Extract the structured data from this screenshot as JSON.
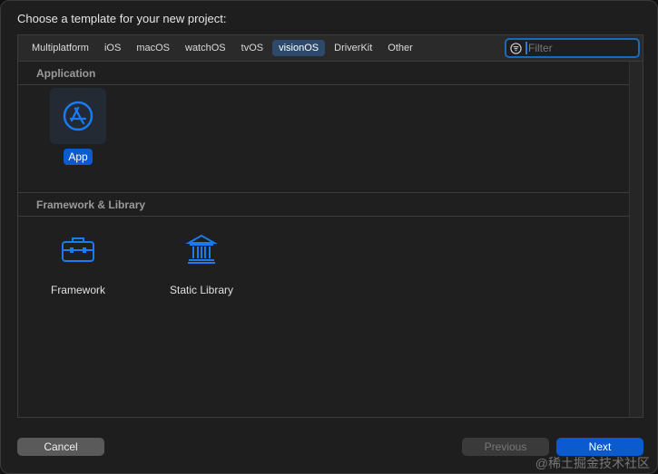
{
  "title": "Choose a template for your new project:",
  "tabs": [
    {
      "label": "Multiplatform"
    },
    {
      "label": "iOS"
    },
    {
      "label": "macOS"
    },
    {
      "label": "watchOS"
    },
    {
      "label": "tvOS"
    },
    {
      "label": "visionOS",
      "selected": true
    },
    {
      "label": "DriverKit"
    },
    {
      "label": "Other"
    }
  ],
  "filter": {
    "placeholder": "Filter",
    "value": ""
  },
  "sections": [
    {
      "title": "Application",
      "items": [
        {
          "label": "App",
          "icon": "app-store-icon",
          "selected": true
        }
      ]
    },
    {
      "title": "Framework & Library",
      "items": [
        {
          "label": "Framework",
          "icon": "toolbox-icon"
        },
        {
          "label": "Static Library",
          "icon": "library-building-icon"
        }
      ]
    }
  ],
  "buttons": {
    "cancel": "Cancel",
    "previous": "Previous",
    "next": "Next"
  },
  "watermark": "@稀土掘金技术社区",
  "colors": {
    "accent": "#0a5bd0",
    "icon": "#1a7af0"
  }
}
